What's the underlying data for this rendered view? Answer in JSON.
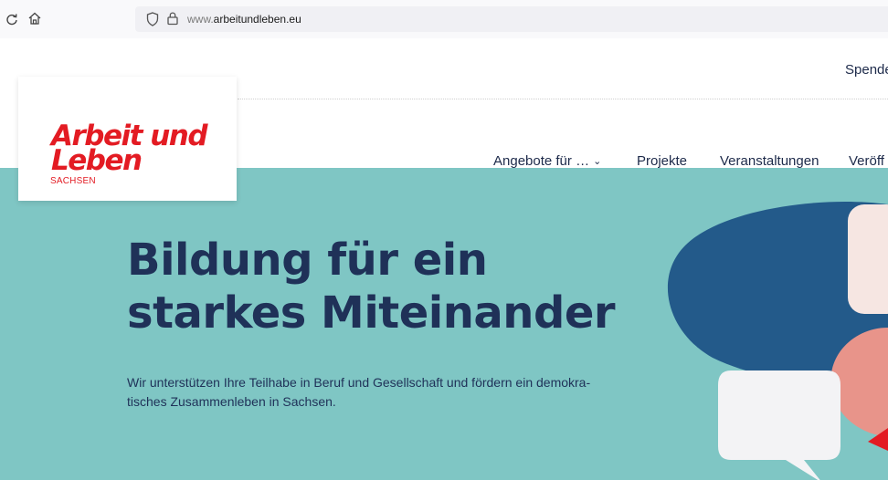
{
  "browser": {
    "url_host": "www.arbeitundleben.eu",
    "url_prefix": "www."
  },
  "header": {
    "spende_label": "Spende"
  },
  "logo": {
    "line1": "Arbeit und",
    "line2": "Leben",
    "sub": "SACHSEN"
  },
  "nav": {
    "items": [
      {
        "label": "Angebote für …"
      },
      {
        "label": "Projekte"
      },
      {
        "label": "Veranstaltungen"
      },
      {
        "label": "Veröff"
      }
    ]
  },
  "hero": {
    "title_line1": "Bildung für ein",
    "title_line2": "starkes Miteinander",
    "text_line1": "Wir unterstützen Ihre Teilhabe in Beruf und Gesellschaft und fördern ein demokra-",
    "text_line2": "tisches Zusammenleben in Sachsen."
  },
  "colors": {
    "brand_red": "#e31b23",
    "navy": "#1f3158",
    "hero_bg": "#7fc6c4",
    "bubble_dark": "#235a8a",
    "bubble_salmon": "#e8948a",
    "bubble_light": "#f3f3f5"
  },
  "icons": [
    "reload-icon",
    "home-icon",
    "shield-icon",
    "lock-icon",
    "chevron-down-icon"
  ]
}
